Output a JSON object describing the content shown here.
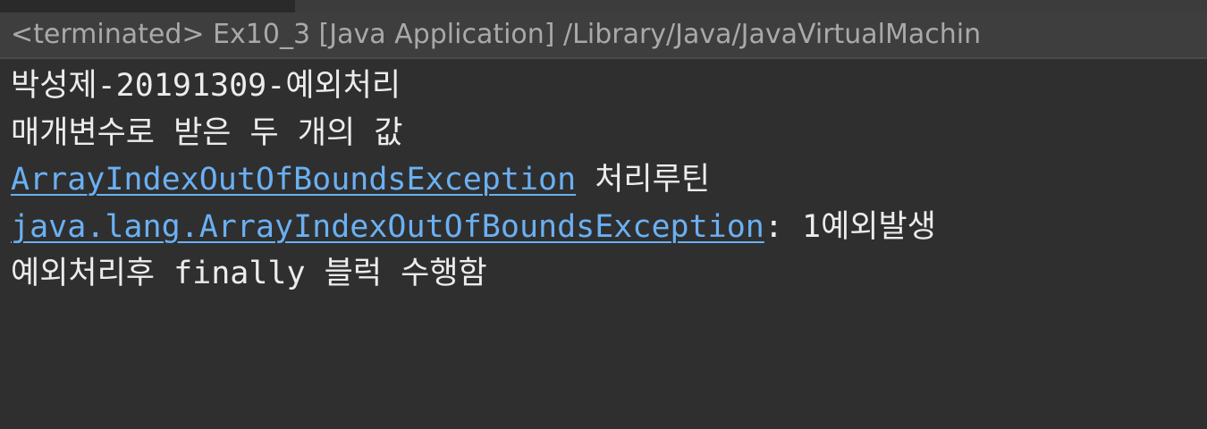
{
  "window": {
    "process_title": "<terminated> Ex10_3 [Java Application] /Library/Java/JavaVirtualMachin"
  },
  "console": {
    "lines": [
      {
        "text": "박성제-20191309-예외처리"
      },
      {
        "text": "매개변수로 받은 두 개의 값"
      },
      {
        "link": "ArrayIndexOutOfBoundsException",
        "rest": " 처리루틴"
      },
      {
        "link": "java.lang.ArrayIndexOutOfBoundsException",
        "rest": ": 1예외발생"
      },
      {
        "text": "예외처리후 finally 블럭 수행함"
      }
    ]
  },
  "colors": {
    "background": "#2f2f2f",
    "header_background": "#3e3e3e",
    "output_text": "#ececec",
    "link_text": "#6ab0f3",
    "title_text": "#a9a9a9"
  }
}
